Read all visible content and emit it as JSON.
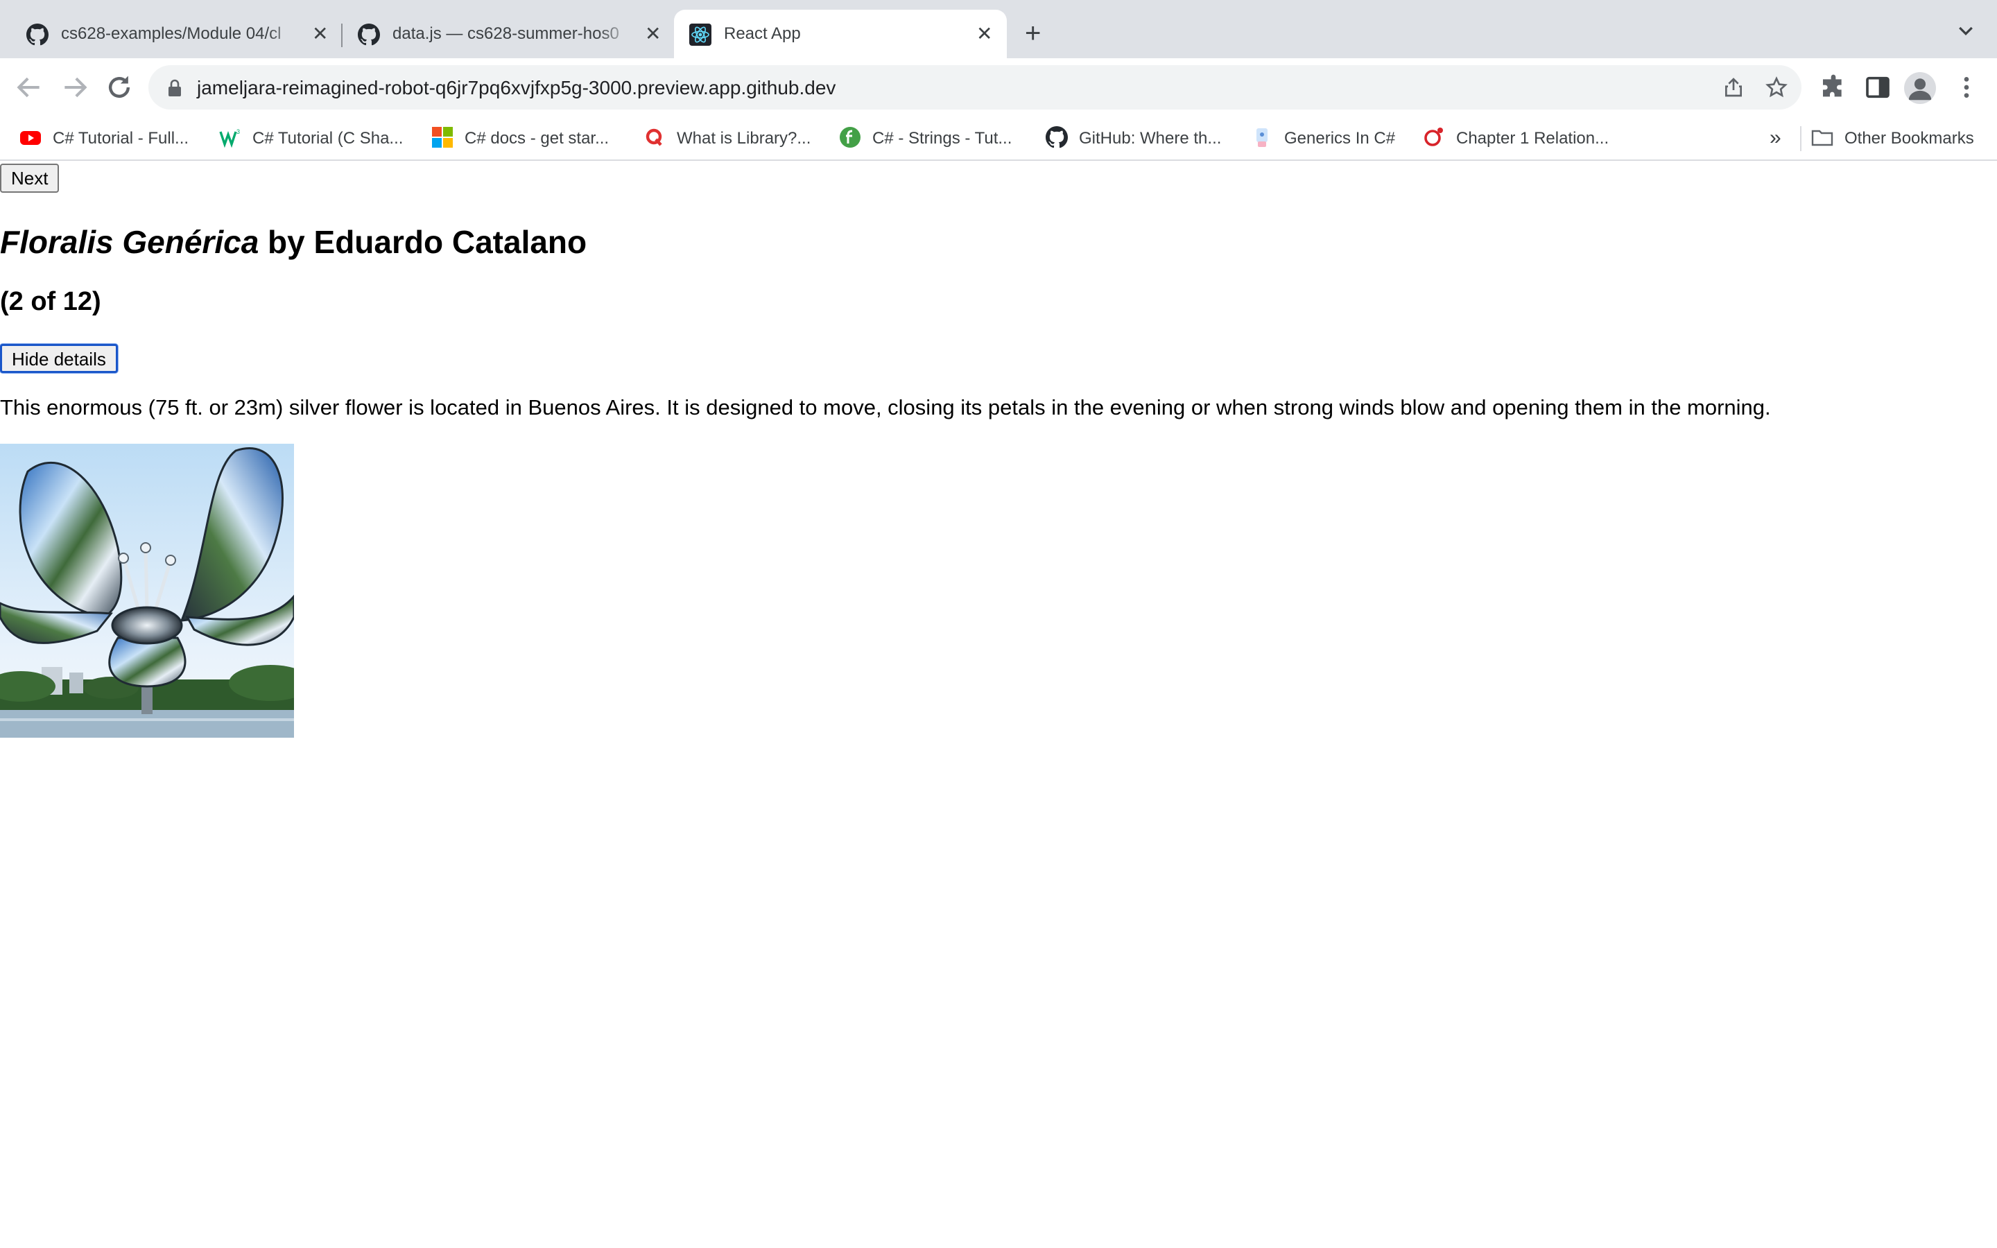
{
  "browser": {
    "tabs": [
      {
        "title": "cs628-examples/Module 04/cl",
        "icon": "github-icon"
      },
      {
        "title": "data.js — cs628-summer-hos0",
        "icon": "github-icon"
      },
      {
        "title": "React App",
        "icon": "react-icon",
        "active": true
      }
    ],
    "url": "jameljara-reimagined-robot-q6jr7pq6xvjfxp5g-3000.preview.app.github.dev",
    "bookmarks": [
      {
        "label": "C# Tutorial - Full...",
        "icon": "youtube-icon"
      },
      {
        "label": "C# Tutorial (C Sha...",
        "icon": "w3schools-icon"
      },
      {
        "label": "C# docs - get star...",
        "icon": "microsoft-icon"
      },
      {
        "label": "What is Library?...",
        "icon": "quora-icon"
      },
      {
        "label": "C# - Strings - Tut...",
        "icon": "tutorialsteacher-icon"
      },
      {
        "label": "GitHub: Where th...",
        "icon": "github-icon"
      },
      {
        "label": "Generics In C#",
        "icon": "csharpcorner-icon"
      },
      {
        "label": "Chapter 1 Relation...",
        "icon": "oracle-icon"
      }
    ],
    "other_bookmarks": "Other Bookmarks"
  },
  "page": {
    "next_button": "Next",
    "sculpture_name": "Floralis Genérica",
    "by_artist": " by Eduardo Catalano",
    "counter": "(2 of 12)",
    "details_button": "Hide details",
    "description": "This enormous (75 ft. or 23m) silver flower is located in Buenos Aires. It is designed to move, closing its petals in the evening or when strong winds blow and opening them in the morning."
  },
  "colors": {
    "tabstrip": "#dee1e6",
    "focus_ring": "#1a56c9"
  }
}
